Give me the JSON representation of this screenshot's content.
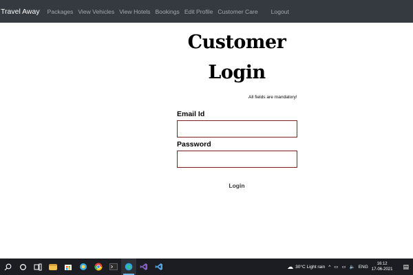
{
  "navbar": {
    "brand": "Travel Away",
    "links": [
      "Packages",
      "View Vehicles",
      "View Hotels",
      "Bookings",
      "Edit Profile",
      "Customer Care"
    ],
    "logout": "Logout"
  },
  "login": {
    "title_line1": "Customer",
    "title_line2": "Login",
    "mandatory_note": "All fields are mandatory!",
    "email_label": "Email Id",
    "email_value": "",
    "password_label": "Password",
    "password_value": "",
    "submit_label": "Login"
  },
  "taskbar": {
    "apps": [
      "file-explorer",
      "store",
      "app",
      "chrome",
      "terminal",
      "edge",
      "visual-studio",
      "vscode"
    ],
    "weather": "30°C  Light rain",
    "language": "ENG",
    "time": "16:12",
    "date": "17-06-2021",
    "colors": {
      "file-explorer": "#f2c14e",
      "store": "#ffffff",
      "app": "#3ba8e0",
      "chrome": "#e0473a",
      "terminal": "#2b2b2b",
      "edge": "#2ea3e3",
      "visual-studio": "#8661c5",
      "vscode": "#4fa6e8"
    }
  }
}
